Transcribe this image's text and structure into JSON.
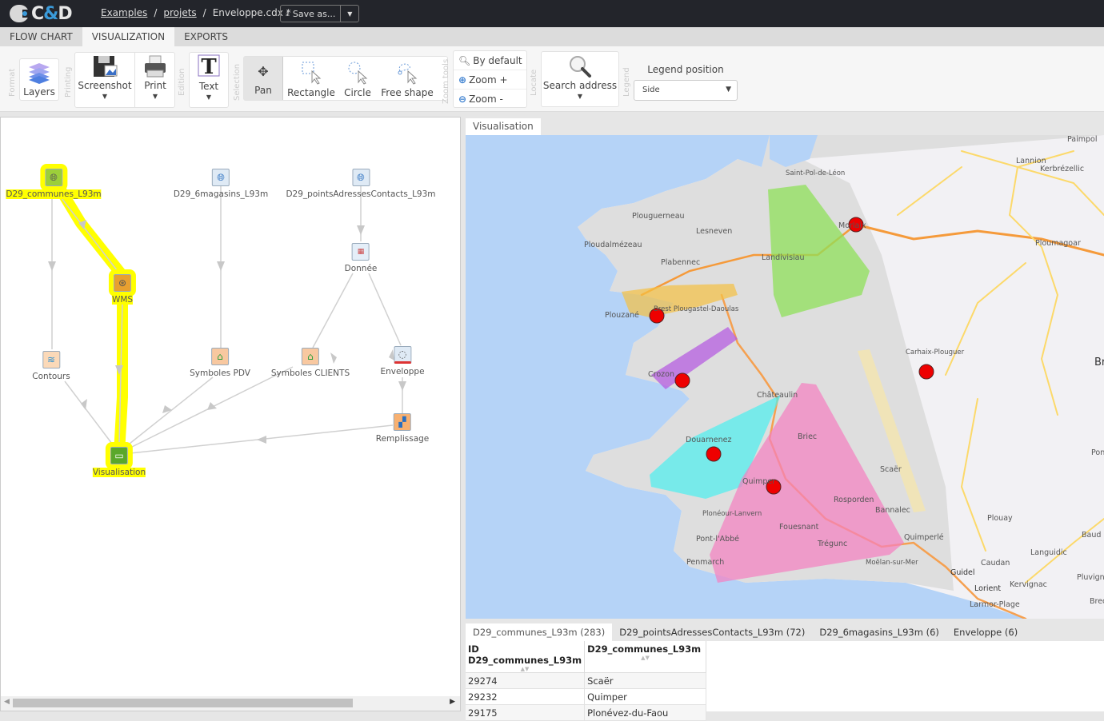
{
  "app": {
    "logo_prefix": "C",
    "logo_amp": "&",
    "logo_suffix": "D"
  },
  "breadcrumb": {
    "items": [
      "Examples",
      "projets"
    ],
    "current": "Enveloppe.cdx *",
    "separator": "/"
  },
  "save_button": {
    "label": "Save as...",
    "icon": "download-icon"
  },
  "tabs": [
    {
      "label": "FLOW CHART"
    },
    {
      "label": "VISUALIZATION",
      "active": true
    },
    {
      "label": "EXPORTS"
    }
  ],
  "ribbon": {
    "groups": {
      "format": "Format",
      "printing": "Printing",
      "edition": "Edition",
      "selection": "Selection",
      "zoom": "Zoom tools",
      "locate": "Locate",
      "legend": "Legend"
    },
    "layers": "Layers",
    "screenshot": "Screenshot",
    "print": "Print",
    "text": "Text",
    "pan": "Pan",
    "rectangle": "Rectangle",
    "circle": "Circle",
    "free_shape": "Free shape",
    "zoom_default": "By default",
    "zoom_in": "Zoom +",
    "zoom_out": "Zoom -",
    "search_address": "Search address",
    "legend_position_label": "Legend position",
    "legend_position_value": "Side"
  },
  "flow": {
    "nodes": [
      {
        "id": "communes",
        "label": "D29_communes_L93m",
        "icon": "globe-icon",
        "highlight": true
      },
      {
        "id": "magasins",
        "label": "D29_6magasins_L93m",
        "icon": "globe-icon"
      },
      {
        "id": "contacts",
        "label": "D29_pointsAdressesContacts_L93m",
        "icon": "globe-icon"
      },
      {
        "id": "wms",
        "label": "WMS",
        "icon": "wms-icon",
        "highlight": true
      },
      {
        "id": "donnee",
        "label": "Donnée",
        "icon": "data-table-icon"
      },
      {
        "id": "contours",
        "label": "Contours",
        "icon": "contours-icon"
      },
      {
        "id": "symb_pdv",
        "label": "Symboles PDV",
        "icon": "symbols-icon"
      },
      {
        "id": "symb_clients",
        "label": "Symboles CLIENTS",
        "icon": "symbols-icon"
      },
      {
        "id": "enveloppe",
        "label": "Enveloppe",
        "icon": "envelope-shape-icon"
      },
      {
        "id": "remplissage",
        "label": "Remplissage",
        "icon": "fill-bucket-icon"
      },
      {
        "id": "visualisation",
        "label": "Visualisation",
        "icon": "monitor-icon",
        "highlight": true
      }
    ]
  },
  "viz_tab": "Visualisation",
  "map": {
    "labels": [
      "Paimpol",
      "Lannion",
      "Kerbrézellic",
      "Saint-Pol-de-Léon",
      "Plouguerneau",
      "Lesneven",
      "Ploumagoar",
      "Ploudalmézeau",
      "Plabennec",
      "Landivisiau",
      "Morlaix",
      "Plouzané",
      "Brest Plougastel-Daoulas",
      "Carhaix-Plouguer",
      "Crozon",
      "Châteaulin",
      "Br",
      "Briec",
      "Douarnenez",
      "Pon",
      "Quimper",
      "Scaër",
      "Rosporden",
      "Bannalec",
      "Plonéour-Lanvern",
      "Plouay",
      "Baud",
      "Pont-l'Abbé",
      "Fouesnant",
      "Trégunc",
      "Quimperlé",
      "Languidic",
      "Penmarch",
      "Moëlan-sur-Mer",
      "Guidel",
      "Caudan",
      "Pluvigner",
      "Lorient",
      "Kervignac",
      "Larmor-Plage",
      "Brech"
    ],
    "envelope_colors": {
      "green": "#8fe05a",
      "orange": "#f5c041",
      "purple": "#b65ee0",
      "cyan": "#4cf0f0",
      "pink": "#f57fc0",
      "yellow": "#f8e7a8"
    },
    "marker_color": "#ee0000"
  },
  "bottom_tabs": [
    {
      "label": "D29_communes_L93m (283)",
      "active": true
    },
    {
      "label": "D29_pointsAdressesContacts_L93m (72)"
    },
    {
      "label": "D29_6magasins_L93m (6)"
    },
    {
      "label": "Enveloppe (6)"
    }
  ],
  "table": {
    "columns": [
      "ID D29_communes_L93m",
      "D29_communes_L93m"
    ],
    "rows": [
      [
        "29274",
        "Scaër"
      ],
      [
        "29232",
        "Quimper"
      ],
      [
        "29175",
        "Plonévez-du-Faou"
      ]
    ]
  }
}
